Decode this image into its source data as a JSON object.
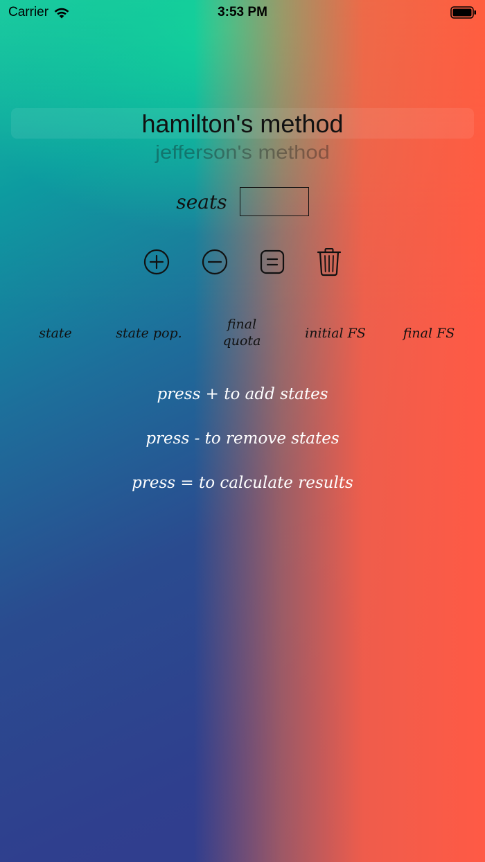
{
  "status_bar": {
    "carrier": "Carrier",
    "time": "3:53 PM"
  },
  "picker": {
    "selected": "hamilton's method",
    "next": "jefferson's method"
  },
  "seats": {
    "label": "seats",
    "value": ""
  },
  "toolbar": {
    "add_icon": "plus-circle-icon",
    "remove_icon": "minus-circle-icon",
    "calculate_icon": "equals-square-icon",
    "delete_icon": "trash-icon"
  },
  "table_header": {
    "columns": [
      "state",
      "state pop.",
      "final\nquota",
      "initial FS",
      "final FS"
    ]
  },
  "instructions": {
    "add": "press + to add states",
    "remove": "press - to remove states",
    "calculate": "press = to calculate results"
  }
}
